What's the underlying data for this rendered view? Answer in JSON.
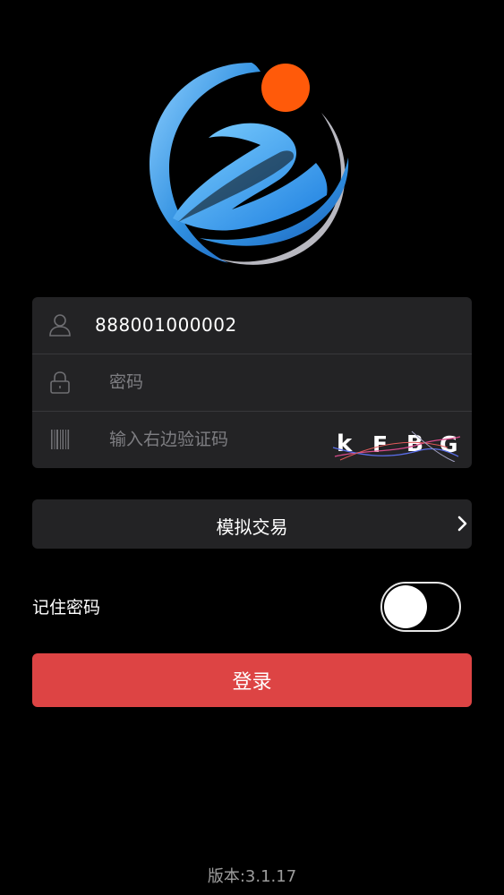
{
  "login": {
    "username": "888001000002",
    "password_placeholder": "密码",
    "captcha_placeholder": "输入右边验证码",
    "captcha_code": [
      "k",
      "F",
      "B",
      "G"
    ]
  },
  "mode": {
    "label": "模拟交易"
  },
  "remember": {
    "label": "记住密码",
    "enabled": false
  },
  "submit": {
    "label": "登录"
  },
  "footer": {
    "version": "版本:3.1.17"
  },
  "colors": {
    "background": "#000000",
    "panel": "#232325",
    "primary": "#dd4444",
    "logo_blue": "#2f8fe0",
    "logo_orange": "#ff5a0a"
  },
  "icons": {
    "username": "user-icon",
    "password": "lock-icon",
    "captcha": "barcode-icon",
    "mode": "chevron-right-icon"
  }
}
